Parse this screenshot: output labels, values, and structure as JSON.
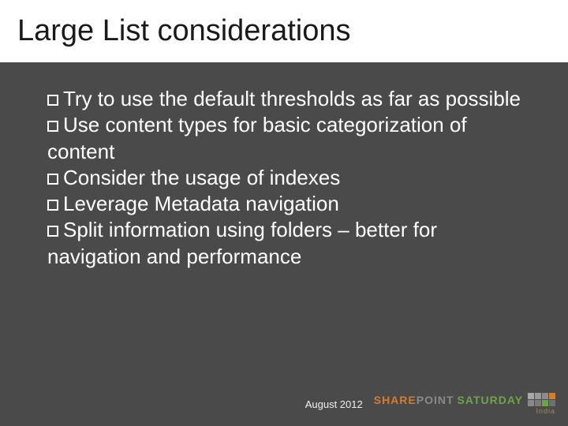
{
  "title": "Large List considerations",
  "bullets": [
    "Try to use the default thresholds as far as possible",
    "Use content types for basic categorization of content",
    "Consider the usage of indexes",
    "Leverage Metadata navigation",
    "Split information using folders – better for navigation and performance"
  ],
  "footer": {
    "date": "August 2012",
    "logo": {
      "share": "SHARE",
      "point": "POINT",
      "saturday": "SATURDAY",
      "india": "India"
    }
  }
}
